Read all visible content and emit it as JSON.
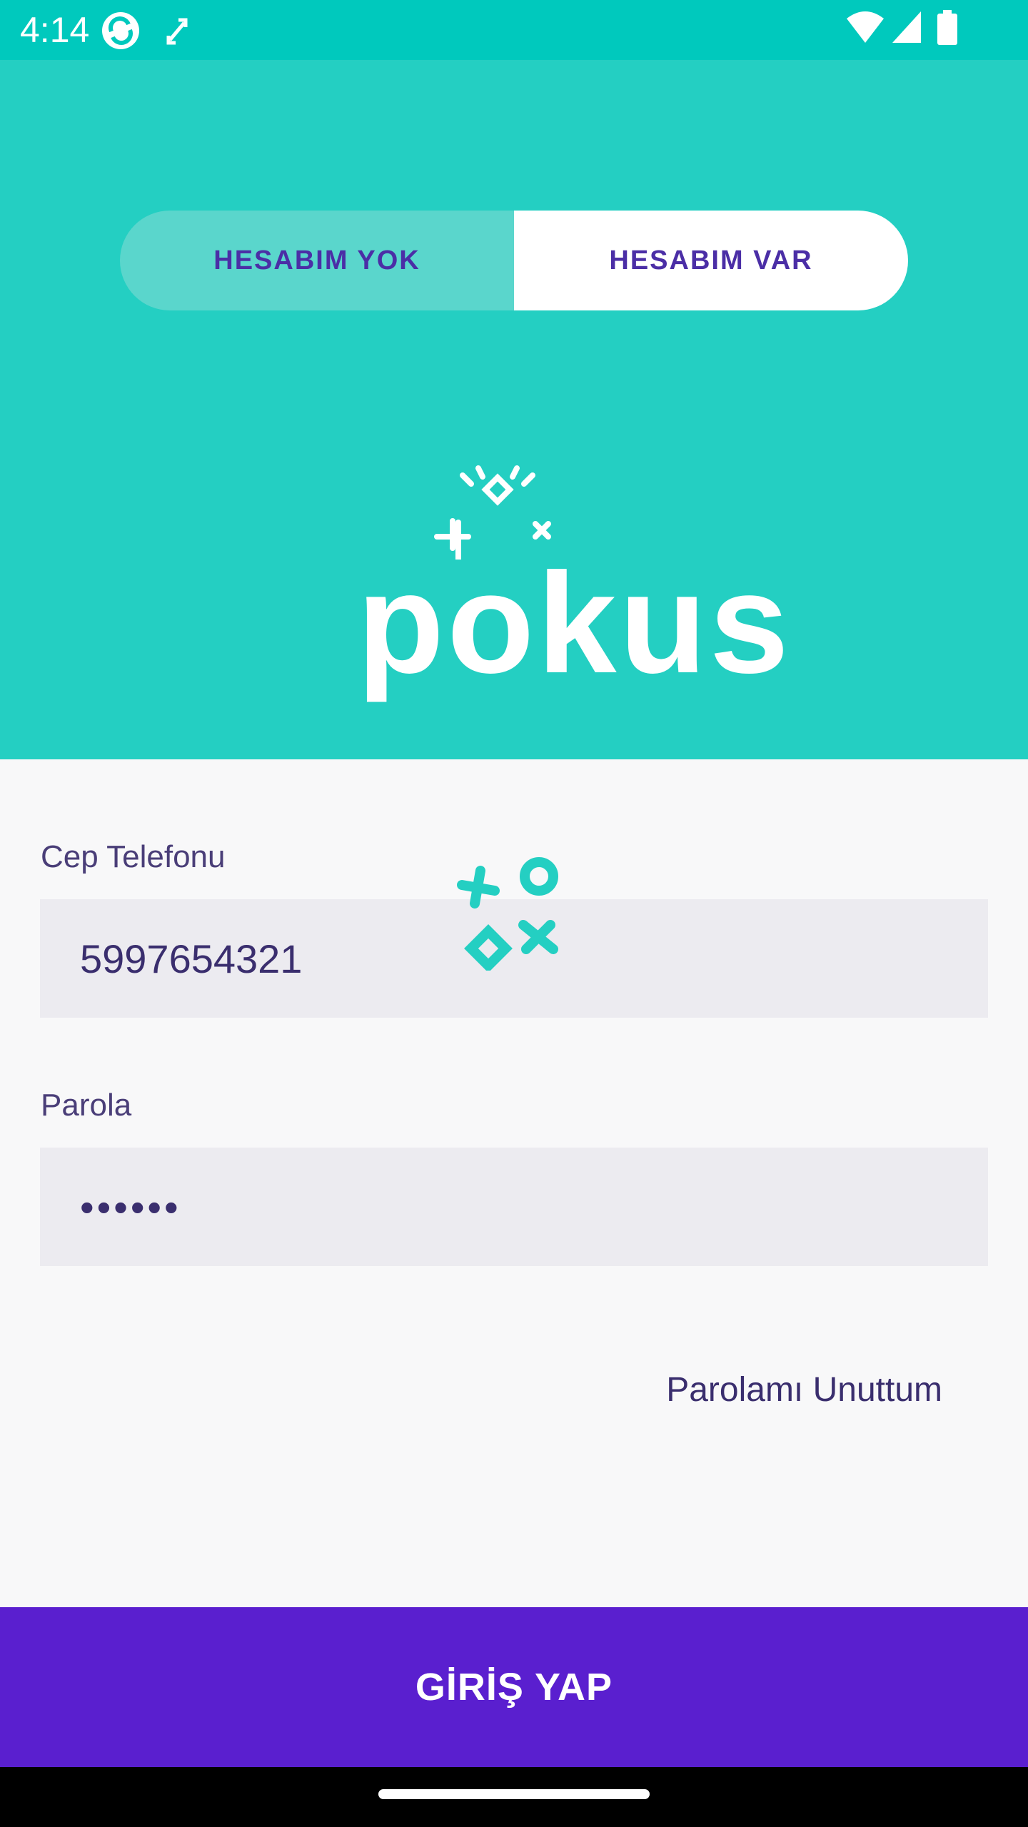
{
  "status_bar": {
    "time": "4:14",
    "icons": [
      "sync-app-icon",
      "screen-rotate-icon",
      "wifi-icon",
      "signal-icon",
      "battery-icon"
    ]
  },
  "tabs": {
    "no_account": "HESABIM YOK",
    "have_account": "HESABIM VAR",
    "selected": "HESABIM VAR"
  },
  "logo": {
    "text": "pokus"
  },
  "form": {
    "phone_label": "Cep Telefonu",
    "phone_value": "5997654321",
    "password_label": "Parola",
    "password_value": "••••••"
  },
  "links": {
    "forgot_password": "Parolamı Unuttum"
  },
  "actions": {
    "login": "GİRİŞ YAP"
  },
  "colors": {
    "status_bar": "#00c9bd",
    "hero": "#24cfc2",
    "tab_unselected": "#5ad6cc",
    "tab_text": "#4b2ea6",
    "field_bg": "#ecebf0",
    "text_dark": "#3a2e6e",
    "primary_button": "#5a1fcf"
  }
}
